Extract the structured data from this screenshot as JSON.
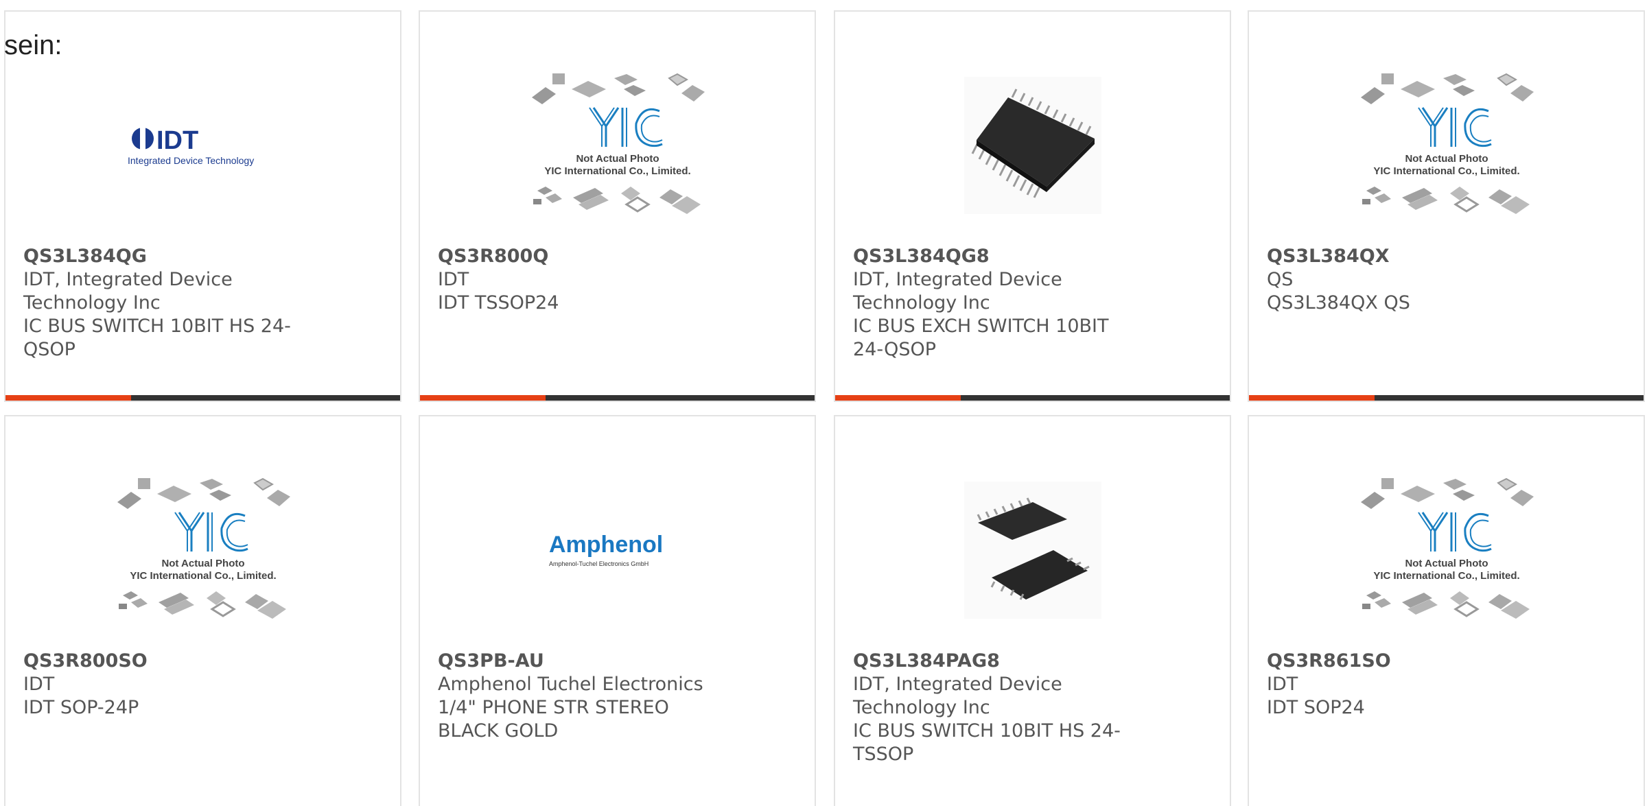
{
  "intro_text": "sein:",
  "colors": {
    "accent": "#e64015",
    "bar": "#333333",
    "card_border": "#e3e3e3",
    "text": "#555555"
  },
  "placeholder": {
    "line1": "Not Actual Photo",
    "line2": "YIC International Co., Limited."
  },
  "logos": {
    "idt_brand": "IDT",
    "idt_sub": "Integrated Device Technology",
    "amphenol_brand": "Amphenol",
    "amphenol_sub": "Amphenol-Tuchel Electronics GmbH"
  },
  "products": [
    {
      "part": "QS3L384QG",
      "manufacturer": "IDT, Integrated Device Technology Inc",
      "description": "IC BUS SWITCH 10BIT HS 24-QSOP",
      "image": "idt-logo"
    },
    {
      "part": "QS3R800Q",
      "manufacturer": "IDT",
      "description": "IDT TSSOP24",
      "image": "yic-placeholder"
    },
    {
      "part": "QS3L384QG8",
      "manufacturer": "IDT, Integrated Device Technology Inc",
      "description": "IC BUS EXCH SWITCH 10BIT 24-QSOP",
      "image": "chip-photo-qsop"
    },
    {
      "part": "QS3L384QX",
      "manufacturer": "QS",
      "description": "QS3L384QX QS",
      "image": "yic-placeholder"
    },
    {
      "part": "QS3R800SO",
      "manufacturer": "IDT",
      "description": "IDT SOP-24P",
      "image": "yic-placeholder"
    },
    {
      "part": "QS3PB-AU",
      "manufacturer": "Amphenol Tuchel Electronics",
      "description": "1/4\" PHONE STR STEREO BLACK GOLD",
      "image": "amphenol-logo"
    },
    {
      "part": "QS3L384PAG8",
      "manufacturer": "IDT, Integrated Device Technology Inc",
      "description": "IC BUS SWITCH 10BIT HS 24-TSSOP",
      "image": "chip-photo-tssop"
    },
    {
      "part": "QS3R861SO",
      "manufacturer": "IDT",
      "description": "IDT SOP24",
      "image": "yic-placeholder"
    }
  ]
}
